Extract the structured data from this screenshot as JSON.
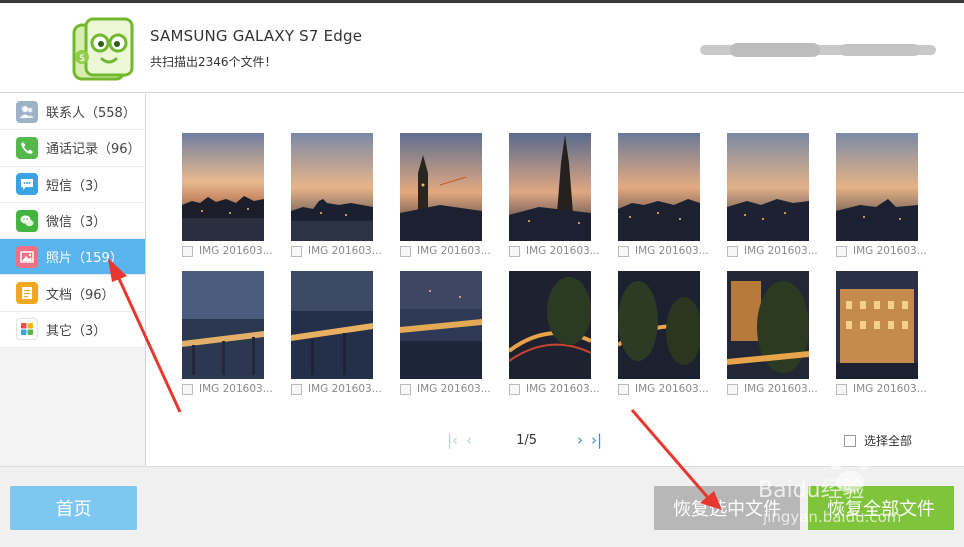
{
  "header": {
    "device_name": "SAMSUNG  GALAXY S7 Edge",
    "scan_summary": "共扫描出2346个文件！"
  },
  "sidebar": {
    "items": [
      {
        "label": "联系人（558）",
        "icon": "contacts-icon",
        "color": "#9fb3c8"
      },
      {
        "label": "通话记录（96）",
        "icon": "phone-icon",
        "color": "#55b84c"
      },
      {
        "label": "短信（3）",
        "icon": "sms-icon",
        "color": "#3aa3e3"
      },
      {
        "label": "微信（3）",
        "icon": "wechat-icon",
        "color": "#43b53f"
      },
      {
        "label": "照片（159）",
        "icon": "photo-icon",
        "color": "#ef6f86",
        "active": true
      },
      {
        "label": "文档（96）",
        "icon": "document-icon",
        "color": "#f0a91e"
      },
      {
        "label": "其它（3）",
        "icon": "other-icon",
        "color": "#ffffff"
      }
    ]
  },
  "photos": {
    "row1": [
      {
        "caption": "IMG 201603..."
      },
      {
        "caption": "IMG 201603..."
      },
      {
        "caption": "IMG 201603..."
      },
      {
        "caption": "IMG 201603..."
      },
      {
        "caption": "IMG 201603..."
      },
      {
        "caption": "IMG 201603..."
      },
      {
        "caption": "IMG 201603..."
      }
    ],
    "row2": [
      {
        "caption": "IMG 201603..."
      },
      {
        "caption": "IMG 201603..."
      },
      {
        "caption": "IMG 201603..."
      },
      {
        "caption": "IMG 201603..."
      },
      {
        "caption": "IMG 201603..."
      },
      {
        "caption": "IMG 201603..."
      },
      {
        "caption": "IMG 201603..."
      }
    ]
  },
  "pager": {
    "first": "|‹",
    "prev": "‹",
    "page": "1/5",
    "next": "›",
    "last": "›|"
  },
  "select_all_label": "选择全部",
  "footer": {
    "home_label": "首页",
    "recover_selected_label": "恢复选中文件",
    "recover_all_label": "恢复全部文件"
  },
  "watermark": {
    "text": "Baidu经验",
    "sub": "jingyan.baidu.com"
  },
  "colors": {
    "accent_blue": "#5ab4ee",
    "green_button": "#7fc43b",
    "grey_button": "#b7b7b7",
    "home_button": "#7ec7f0",
    "arrow_red": "#e8372f"
  }
}
